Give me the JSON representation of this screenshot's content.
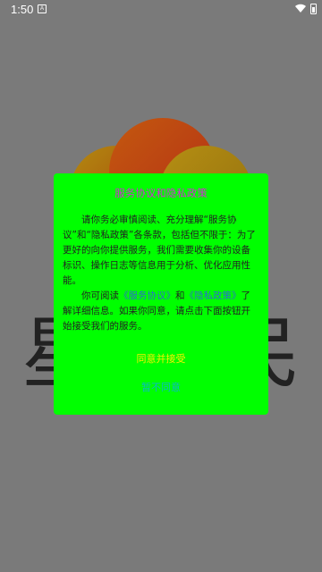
{
  "status_bar": {
    "time": "1:50",
    "notification_icon": "A"
  },
  "splash": {
    "title_left": "星",
    "title_right": "民"
  },
  "dialog": {
    "title": "服务协议和隐私政策",
    "paragraph1": "请你务必审慎阅读、充分理解“服务协议”和“隐私政策”各条款，包括但不限于：为了更好的向你提供服务，我们需要收集你的设备标识、操作日志等信息用于分析、优化应用性能。",
    "paragraph2_prefix": "你可阅读",
    "service_link": "《服务协议》",
    "and_text": "和",
    "privacy_link": "《隐私政策》",
    "paragraph2_suffix": "了解详细信息。如果你同意，请点击下面按钮开始接受我们的服务。",
    "agree_label": "同意并接受",
    "disagree_label": "暂不同意"
  }
}
